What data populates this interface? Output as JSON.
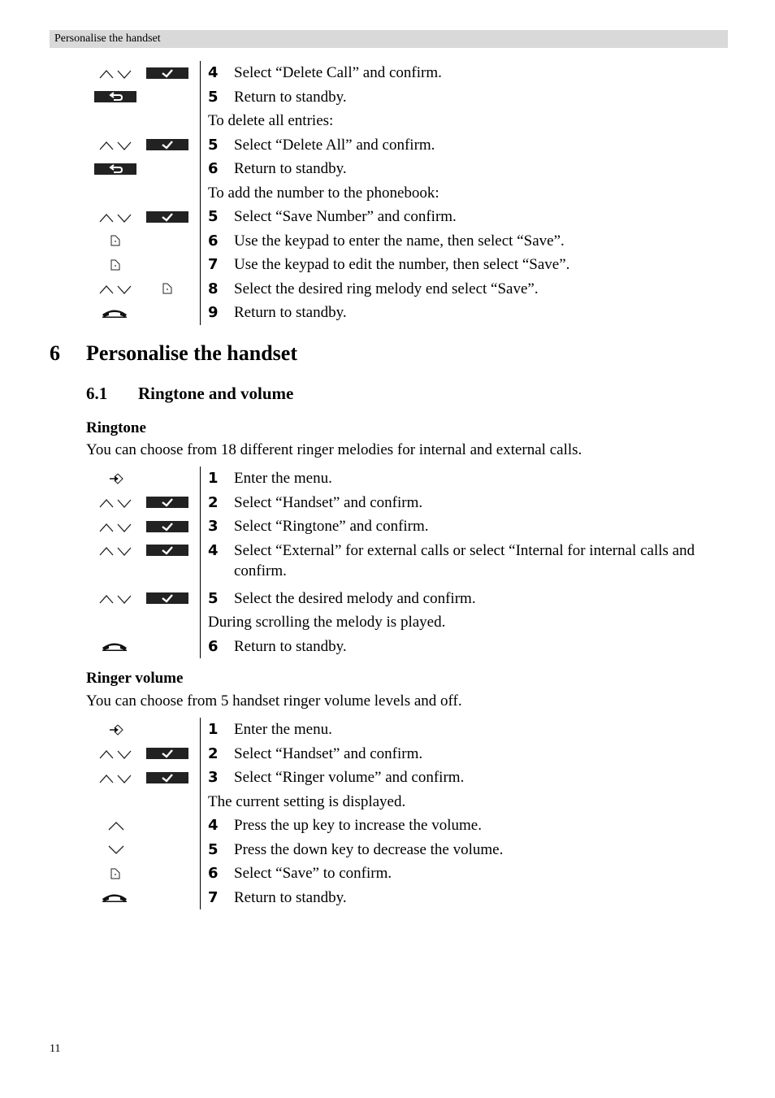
{
  "header": {
    "running_title": "Personalise the handset"
  },
  "block1": [
    {
      "icons": [
        "updown",
        "ok"
      ],
      "num": "4",
      "text": "Select “Delete Call” and confirm."
    },
    {
      "icons": [
        "back"
      ],
      "num": "5",
      "text": "Return to standby."
    },
    {
      "icons": [],
      "note": "To delete all entries:"
    },
    {
      "icons": [
        "updown",
        "ok"
      ],
      "num": "5",
      "text": "Select “Delete All” and confirm."
    },
    {
      "icons": [
        "back"
      ],
      "num": "6",
      "text": "Return to standby."
    },
    {
      "icons": [],
      "note": "To add the number to the phonebook:"
    },
    {
      "icons": [
        "updown",
        "ok"
      ],
      "num": "5",
      "text": "Select “Save Number” and confirm."
    },
    {
      "icons": [
        "softkey"
      ],
      "num": "6",
      "text": "Use the keypad to enter the name, then select “Save”."
    },
    {
      "icons": [
        "softkey"
      ],
      "num": "7",
      "text": "Use the keypad to edit the number, then select “Save”."
    },
    {
      "icons": [
        "updown",
        "softkey2"
      ],
      "num": "8",
      "text": "Select the desired ring melody end select “Save”."
    },
    {
      "icons": [
        "hangup"
      ],
      "num": "9",
      "text": "Return to standby."
    }
  ],
  "section": {
    "number": "6",
    "title": "Personalise the handset"
  },
  "subsection": {
    "number": "6.1",
    "title": "Ringtone and volume"
  },
  "ringtone": {
    "heading": "Ringtone",
    "intro": "You can choose from 18 different ringer melodies for internal and external calls.",
    "steps": [
      {
        "icons": [
          "menu"
        ],
        "num": "1",
        "text": "Enter the menu."
      },
      {
        "icons": [
          "updown",
          "ok"
        ],
        "num": "2",
        "text": "Select “Handset” and confirm."
      },
      {
        "icons": [
          "updown",
          "ok"
        ],
        "num": "3",
        "text": "Select “Ringtone” and confirm."
      },
      {
        "icons": [
          "updown",
          "ok"
        ],
        "num": "4",
        "text": "Select “External” for external calls or select “Internal for internal calls and",
        "text2": "confirm."
      },
      {
        "icons": [
          "updown",
          "ok"
        ],
        "num": "5",
        "text": "Select the desired melody and confirm."
      },
      {
        "icons": [],
        "note": "During scrolling the melody is played."
      },
      {
        "icons": [
          "hangup"
        ],
        "num": "6",
        "text": "Return to standby."
      }
    ]
  },
  "volume": {
    "heading": "Ringer volume",
    "intro": "You can choose from 5 handset ringer volume levels and off.",
    "steps": [
      {
        "icons": [
          "menu"
        ],
        "num": "1",
        "text": "Enter the menu."
      },
      {
        "icons": [
          "updown",
          "ok"
        ],
        "num": "2",
        "text": "Select “Handset” and confirm."
      },
      {
        "icons": [
          "updown",
          "ok"
        ],
        "num": "3",
        "text": "Select “Ringer volume” and confirm."
      },
      {
        "icons": [],
        "note": "The current setting is displayed."
      },
      {
        "icons": [
          "up"
        ],
        "num": "4",
        "text": "Press the up key to increase the volume."
      },
      {
        "icons": [
          "down"
        ],
        "num": "5",
        "text": "Press the down key to decrease the volume."
      },
      {
        "icons": [
          "softkey"
        ],
        "num": "6",
        "text": "Select “Save” to confirm."
      },
      {
        "icons": [
          "hangup"
        ],
        "num": "7",
        "text": "Return to standby."
      }
    ]
  },
  "footer": {
    "page_number": "11"
  }
}
